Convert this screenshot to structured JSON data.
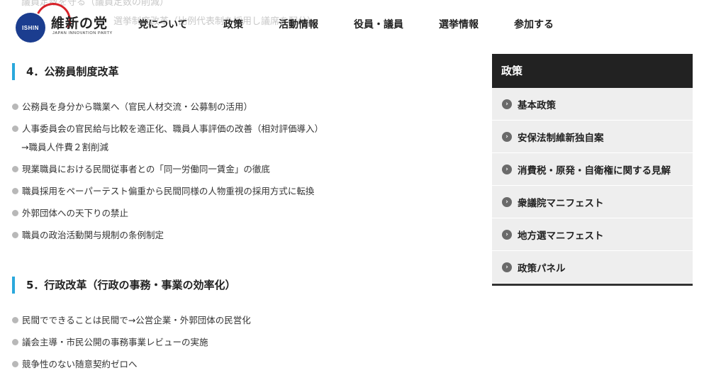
{
  "ghost_text": {
    "line1": "議員定数を守る（議員定数の削減）",
    "line2": "選挙制度改革（比例代表制を採用し議席を配分）"
  },
  "header": {
    "logo": {
      "circle_text": "ISHIN",
      "name": "維新の党",
      "sub": "JAPAN INNOVATION PARTY"
    },
    "nav": [
      "党について",
      "政策",
      "活動情報",
      "役員・議員",
      "選挙情報",
      "参加する"
    ]
  },
  "sections": [
    {
      "heading": "4．公務員制度改革",
      "items": [
        "公務員を身分から職業へ（官民人材交流・公募制の活用）",
        "人事委員会の官民給与比較を適正化、職員人事評価の改善（相対評価導入）",
        "→職員人件費２割削減",
        "現業職員における民間従事者との「同一労働同一賃金」の徹底",
        "職員採用をペーパーテスト偏重から民間同様の人物重視の採用方式に転換",
        "外郭団体への天下りの禁止",
        "職員の政治活動関与規制の条例制定"
      ]
    },
    {
      "heading": "5．行政改革（行政の事務・事業の効率化）",
      "items": [
        "民間でできることは民間で→公営企業・外郭団体の民営化",
        "議会主導・市民公開の事務事業レビューの実施",
        "競争性のない随意契約ゼロへ"
      ]
    }
  ],
  "sidebar": {
    "title": "政策",
    "items": [
      "基本政策",
      "安保法制維新独自案",
      "消費税・原発・自衛権に関する見解",
      "衆議院マニフェスト",
      "地方選マニフェスト",
      "政策パネル"
    ],
    "icon": "chevron-right-icon"
  },
  "colors": {
    "accent": "#2aa8dc",
    "sidebar_title_bg": "#222222",
    "sidebar_item_bg": "#eeeeee",
    "logo_blue": "#1b3d8f",
    "logo_red": "#d8232a"
  }
}
